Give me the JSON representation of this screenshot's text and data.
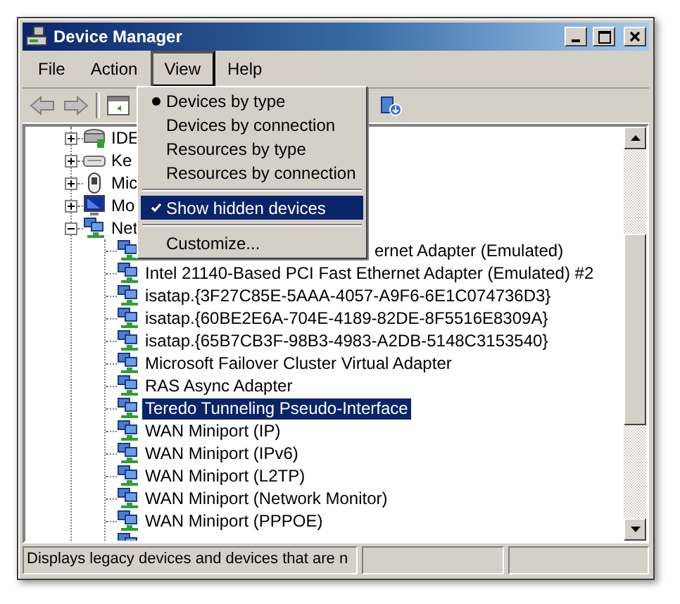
{
  "window": {
    "title": "Device Manager"
  },
  "menu_bar": [
    {
      "label": "File",
      "selected": false
    },
    {
      "label": "Action",
      "selected": false
    },
    {
      "label": "View",
      "selected": true
    },
    {
      "label": "Help",
      "selected": false
    }
  ],
  "view_menu": {
    "items": [
      {
        "kind": "radio",
        "label": "Devices by type",
        "checked": true,
        "highlighted": false
      },
      {
        "kind": "radio",
        "label": "Devices by connection",
        "checked": false,
        "highlighted": false
      },
      {
        "kind": "radio",
        "label": "Resources by type",
        "checked": false,
        "highlighted": false
      },
      {
        "kind": "radio",
        "label": "Resources by connection",
        "checked": false,
        "highlighted": false
      },
      {
        "kind": "separator"
      },
      {
        "kind": "check",
        "label": "Show hidden devices",
        "checked": true,
        "highlighted": true
      },
      {
        "kind": "separator"
      },
      {
        "kind": "command",
        "label": "Customize...",
        "highlighted": false
      }
    ]
  },
  "tree": [
    {
      "kind": "ide",
      "label": "IDE",
      "expanded": false
    },
    {
      "kind": "keyboard",
      "label": "Ke",
      "expanded": false
    },
    {
      "kind": "mouse",
      "label": "Mic",
      "expanded": false
    },
    {
      "kind": "monitor",
      "label": "Mo",
      "expanded": false
    },
    {
      "kind": "network",
      "label": "Net",
      "expanded": true,
      "children": [
        {
          "label": "ernet Adapter (Emulated)",
          "under_menu": true,
          "selected": false
        },
        {
          "label": "Intel 21140-Based PCI Fast Ethernet Adapter (Emulated) #2",
          "under_menu": false,
          "selected": false
        },
        {
          "label": "isatap.{3F27C85E-5AAA-4057-A9F6-6E1C074736D3}",
          "under_menu": false,
          "selected": false
        },
        {
          "label": "isatap.{60BE2E6A-704E-4189-82DE-8F5516E8309A}",
          "under_menu": false,
          "selected": false
        },
        {
          "label": "isatap.{65B7CB3F-98B3-4983-A2DB-5148C3153540}",
          "under_menu": false,
          "selected": false
        },
        {
          "label": "Microsoft Failover Cluster Virtual Adapter",
          "under_menu": false,
          "selected": false
        },
        {
          "label": "RAS Async Adapter",
          "under_menu": false,
          "selected": false
        },
        {
          "label": "Teredo Tunneling Pseudo-Interface",
          "under_menu": false,
          "selected": true
        },
        {
          "label": "WAN Miniport (IP)",
          "under_menu": false,
          "selected": false
        },
        {
          "label": "WAN Miniport (IPv6)",
          "under_menu": false,
          "selected": false
        },
        {
          "label": "WAN Miniport (L2TP)",
          "under_menu": false,
          "selected": false
        },
        {
          "label": "WAN Miniport (Network Monitor)",
          "under_menu": false,
          "selected": false
        },
        {
          "label": "WAN Miniport (PPPOE)",
          "under_menu": false,
          "selected": false
        }
      ]
    }
  ],
  "status_bar": {
    "text": "Displays legacy devices and devices that are n"
  }
}
